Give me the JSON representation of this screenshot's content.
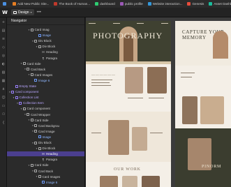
{
  "browser": {
    "bookmarks": [
      {
        "label": "",
        "color": "#4a90e2"
      },
      {
        "label": "Add New Public Site...",
        "color": "#e67e22"
      },
      {
        "label": "The Book of Human...",
        "color": "#c0392b"
      },
      {
        "label": "dashboard",
        "color": "#2ecc71"
      },
      {
        "label": "public profile",
        "color": "#9b59b6"
      },
      {
        "label": "Website interaction...",
        "color": "#3498db"
      },
      {
        "label": "Genesis",
        "color": "#e74c3c"
      },
      {
        "label": "Asset Dashboard",
        "color": "#1abc9c"
      }
    ]
  },
  "topbar": {
    "logo": "W",
    "mode_label": "Design",
    "more": "•••"
  },
  "navigator": {
    "title": "Navigator",
    "rows": [
      {
        "label": "Card Imag",
        "indent": 5,
        "variant": "normal",
        "caret": "▾"
      },
      {
        "label": "Image",
        "indent": 7,
        "variant": "blue",
        "caret": ""
      },
      {
        "label": "Div Block",
        "indent": 6,
        "variant": "normal",
        "caret": "▾"
      },
      {
        "label": "Div Block",
        "indent": 7,
        "variant": "normal",
        "caret": "▾"
      },
      {
        "label": "Heading",
        "indent": 8,
        "variant": "normal",
        "caret": "",
        "sym": "H"
      },
      {
        "label": "Paragra",
        "indent": 8,
        "variant": "normal",
        "caret": "",
        "sym": "¶"
      },
      {
        "label": "Card Side",
        "indent": 3,
        "variant": "normal",
        "caret": "▾"
      },
      {
        "label": "Card Back",
        "indent": 4,
        "variant": "normal",
        "caret": "▾"
      },
      {
        "label": "Card Images",
        "indent": 5,
        "variant": "normal",
        "caret": "▾"
      },
      {
        "label": "Image 6",
        "indent": 6,
        "variant": "blue",
        "caret": ""
      },
      {
        "label": "Empty State",
        "indent": 1,
        "variant": "purple",
        "caret": ""
      },
      {
        "label": "Card component",
        "indent": 0,
        "variant": "purple",
        "caret": "▾"
      },
      {
        "label": "Collection List",
        "indent": 1,
        "variant": "purple",
        "caret": "▾"
      },
      {
        "label": "Collection Item",
        "indent": 2,
        "variant": "purple",
        "caret": "▾"
      },
      {
        "label": "Card component",
        "indent": 3,
        "variant": "normal",
        "caret": "▾"
      },
      {
        "label": "Card Wrapper",
        "indent": 4,
        "variant": "normal",
        "caret": "▾"
      },
      {
        "label": "Card Side",
        "indent": 5,
        "variant": "normal",
        "caret": "▾"
      },
      {
        "label": "Card Backgrou",
        "indent": 6,
        "variant": "normal",
        "caret": "▾"
      },
      {
        "label": "Card Image",
        "indent": 6,
        "variant": "normal",
        "caret": "▾"
      },
      {
        "label": "Image",
        "indent": 7,
        "variant": "blue",
        "caret": ""
      },
      {
        "label": "Div Block",
        "indent": 6,
        "variant": "normal",
        "caret": "▾"
      },
      {
        "label": "Div Block",
        "indent": 7,
        "variant": "normal",
        "caret": "▾"
      },
      {
        "label": "Heading",
        "indent": 8,
        "variant": "selected",
        "caret": "",
        "sym": "H"
      },
      {
        "label": "Paragra",
        "indent": 8,
        "variant": "normal",
        "caret": "",
        "sym": "¶"
      },
      {
        "label": "Card Side",
        "indent": 5,
        "variant": "normal",
        "caret": "▾"
      },
      {
        "label": "Card Back",
        "indent": 6,
        "variant": "normal",
        "caret": "▾"
      },
      {
        "label": "Card Images",
        "indent": 7,
        "variant": "normal",
        "caret": "▾"
      },
      {
        "label": "Image 6",
        "indent": 8,
        "variant": "blue",
        "caret": ""
      }
    ]
  },
  "canvas": {
    "page1": {
      "hero_title": "PHOTOGRAPHY",
      "section_heading": "OUR WORK"
    },
    "page2": {
      "hero_title_line1": "CAPTURE YOUR",
      "hero_title_line2": "MEMORY",
      "side_heading": "PINORM"
    }
  }
}
